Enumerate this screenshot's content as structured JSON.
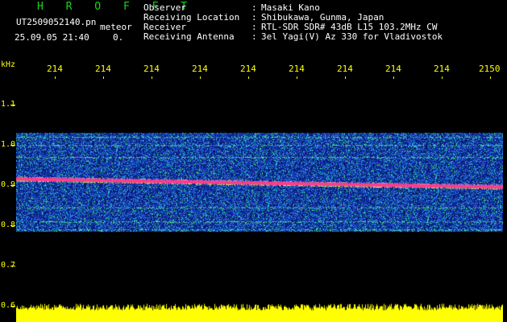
{
  "header": {
    "brand": "H R O F F T",
    "filename": "UT2509052140.pn",
    "event_type": "meteor",
    "datetime": "25.09.05 21:40",
    "count": "0."
  },
  "info": [
    {
      "label": "Observer",
      "value": "Masaki Kano"
    },
    {
      "label": "Receiving Location",
      "value": "Shibukawa, Gunma, Japan"
    },
    {
      "label": "Receiver",
      "value": "RTL-SDR SDR# 43dB L15 103.2MHz CW"
    },
    {
      "label": "Receiving Antenna",
      "value": "3el Yagi(V) Az 330 for Vladivostok"
    }
  ],
  "axes": {
    "y_unit": "kHz",
    "y_labels": [
      "1.1",
      "1.0",
      "0.9",
      "0.8",
      "0.7",
      "0.6"
    ],
    "x_labels": [
      "214",
      "214",
      "214",
      "214",
      "214",
      "214",
      "214",
      "214",
      "214",
      "2150"
    ]
  },
  "colors": {
    "axis_text": "#ffff00",
    "brand": "#19d419",
    "carrier": "#ff3c8c",
    "power_trace": "#ffff00"
  },
  "spectrogram": {
    "band_top_khz": 1.03,
    "band_bottom_khz": 0.785,
    "carrier_start_khz": 0.915,
    "carrier_end_khz": 0.895,
    "bright_lines_khz": [
      1.02,
      1.0,
      0.97,
      0.845,
      0.81,
      0.79
    ],
    "power_floor_level": 0.7
  }
}
